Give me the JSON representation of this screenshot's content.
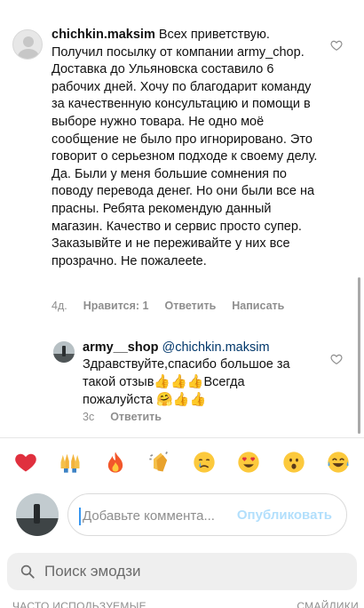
{
  "comment": {
    "username": "chichkin.maksim",
    "text": " Всех приветствую. Получил посылку от компании army_chop. Доставка  до Ульяновска составило 6 рабочих дней. Хочу по благодарит команду за качественную консультацию и  помощи в выборе нужно товара. Не одно моё сообщение не было про игнорировано. Это говорит о серьезном подходе к своему делу. Да. Были у меня большие сомнения по поводу перевода денег. Но они были все на прасны. Ребята рекомендую данный магазин. Качество и сервис просто супер. Заказывйте и не переживайте у них все прозрачно. Не пожалееte.",
    "time": "4д.",
    "likes_label": "Нравится: 1",
    "reply_label": "Ответить",
    "message_label": "Написать"
  },
  "reply": {
    "username": "army__shop",
    "mention": "@chichkin.maksim",
    "text_part1": "Здравствуйте,спасибо большое за такой отзыв",
    "emoji1": "👍👍👍",
    "text_part2": "Всегда пожалуйста ",
    "emoji2": "🤗👍👍",
    "time": "3с",
    "reply_label": "Ответить"
  },
  "quick_emojis": [
    "heart",
    "raised-hands",
    "fire",
    "clapping-hands",
    "crying-face",
    "heart-eyes",
    "surprised-face",
    "laughing-face"
  ],
  "compose": {
    "placeholder": "Добавьте коммента...",
    "publish_label": "Опубликовать"
  },
  "emoji_search": {
    "label": "Поиск эмодзи"
  },
  "categories": {
    "left": "ЧАСТО ИСПОЛЬЗУЕМЫЕ",
    "right": "СМАЙЛИКИ"
  },
  "colors": {
    "accent": "#3897f0",
    "publish_disabled": "#b2dffc",
    "muted": "#8e8e8e",
    "mention": "#00376b"
  }
}
